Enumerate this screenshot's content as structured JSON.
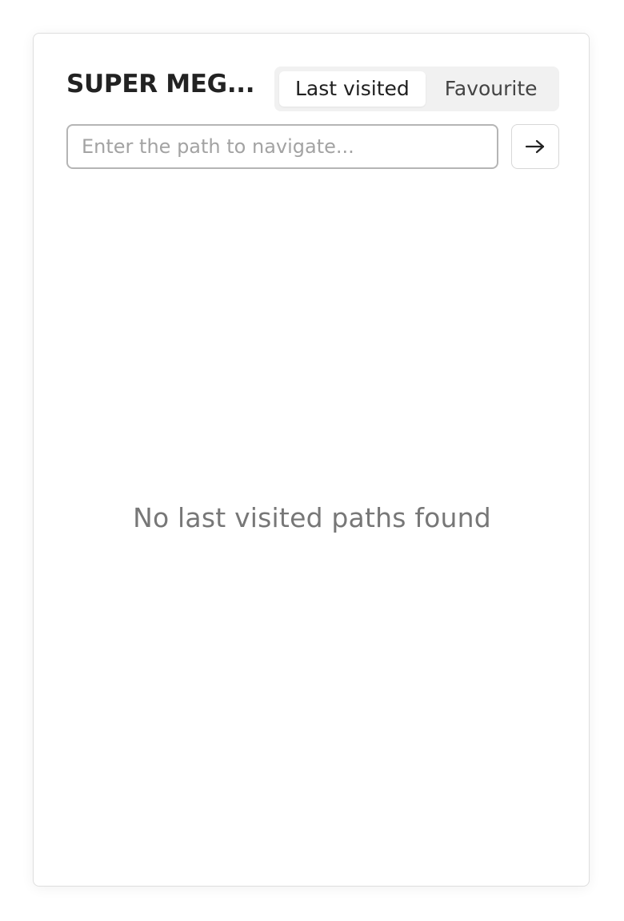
{
  "panel": {
    "title": "SUPER MEG..."
  },
  "tabs": [
    {
      "label": "Last visited",
      "active": true
    },
    {
      "label": "Favourite",
      "active": false
    }
  ],
  "navigate": {
    "value": "",
    "placeholder": "Enter the path to navigate...",
    "go_icon": "arrow-right-icon"
  },
  "empty_state": {
    "message": "No last visited paths found"
  }
}
